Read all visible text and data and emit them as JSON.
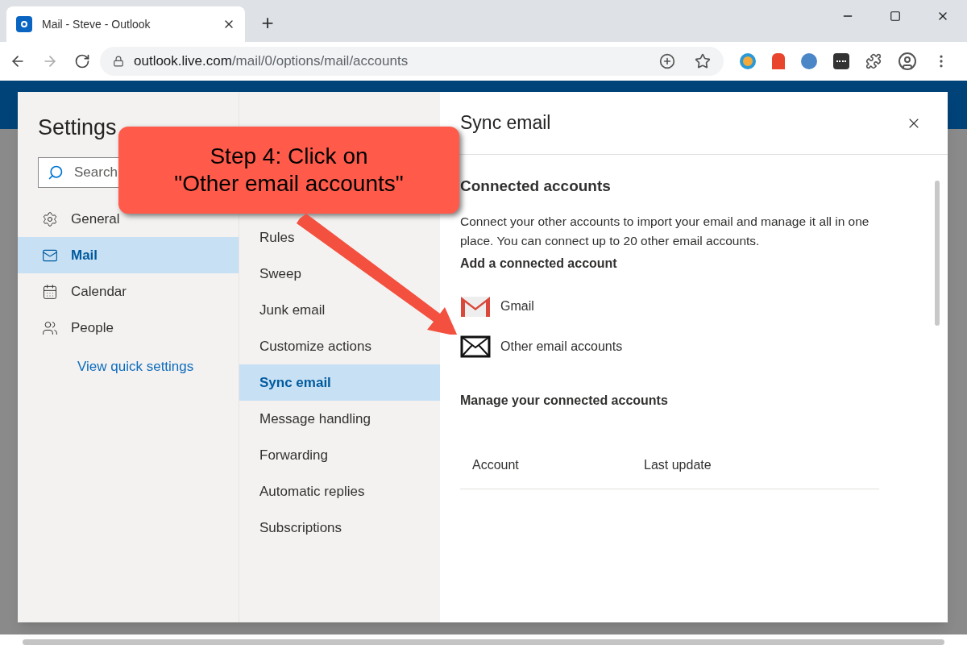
{
  "browser": {
    "tab_title": "Mail - Steve - Outlook",
    "new_tab": "+",
    "url_host": "outlook.live.com",
    "url_path": "/mail/0/options/mail/accounts"
  },
  "settings": {
    "title": "Settings",
    "search": {
      "placeholder": "Search"
    },
    "categories": [
      {
        "label": "General",
        "kind": "gear",
        "selected": false
      },
      {
        "label": "Mail",
        "kind": "mail",
        "selected": true
      },
      {
        "label": "Calendar",
        "kind": "calendar",
        "selected": false
      },
      {
        "label": "People",
        "kind": "people",
        "selected": false
      }
    ],
    "quick_link": "View quick settings"
  },
  "submenu": [
    {
      "label": "Rules",
      "selected": false
    },
    {
      "label": "Sweep",
      "selected": false
    },
    {
      "label": "Junk email",
      "selected": false
    },
    {
      "label": "Customize actions",
      "selected": false
    },
    {
      "label": "Sync email",
      "selected": true
    },
    {
      "label": "Message handling",
      "selected": false
    },
    {
      "label": "Forwarding",
      "selected": false
    },
    {
      "label": "Automatic replies",
      "selected": false
    },
    {
      "label": "Subscriptions",
      "selected": false
    }
  ],
  "panel": {
    "title": "Sync email",
    "section": "Connected accounts",
    "description": "Connect your other accounts to import your email and manage it all in one place. You can connect up to 20 other email accounts.",
    "add_heading": "Add a connected account",
    "accounts": [
      {
        "label": "Gmail",
        "kind": "gmail"
      },
      {
        "label": "Other email accounts",
        "kind": "other"
      }
    ],
    "manage_heading": "Manage your connected accounts",
    "columns": [
      "Account",
      "Last update"
    ]
  },
  "callout": {
    "lines": [
      "Step 4: Click on",
      "\"Other email accounts\""
    ]
  }
}
